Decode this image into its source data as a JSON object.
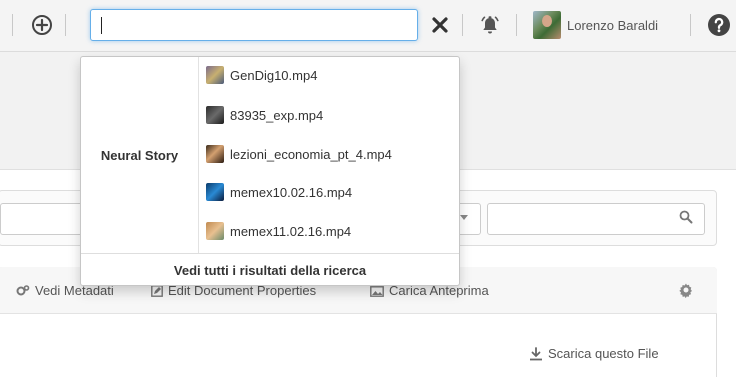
{
  "header": {
    "search": {
      "value": "",
      "placeholder": ""
    },
    "user": {
      "name": "Lorenzo Baraldi"
    },
    "icons": [
      "plus-circle-icon",
      "close-icon",
      "notification-bell-icon",
      "help-icon"
    ]
  },
  "autocomplete": {
    "category": "Neural Story",
    "items": [
      {
        "label": "GenDig10.mp4"
      },
      {
        "label": "83935_exp.mp4"
      },
      {
        "label": "lezioni_economia_pt_4.mp4"
      },
      {
        "label": "memex10.02.16.mp4"
      },
      {
        "label": "memex11.02.16.mp4"
      }
    ],
    "footer": "Vedi tutti i risultati della ricerca"
  },
  "toolbar": {
    "vedi_metadati": "Vedi Metadati",
    "edit_properties": "Edit Document Properties",
    "carica_anteprima": "Carica Anteprima"
  },
  "download": {
    "label": "Scarica questo File"
  },
  "colors": {
    "focus_border": "#66afe9",
    "close_icon": "#333333"
  }
}
